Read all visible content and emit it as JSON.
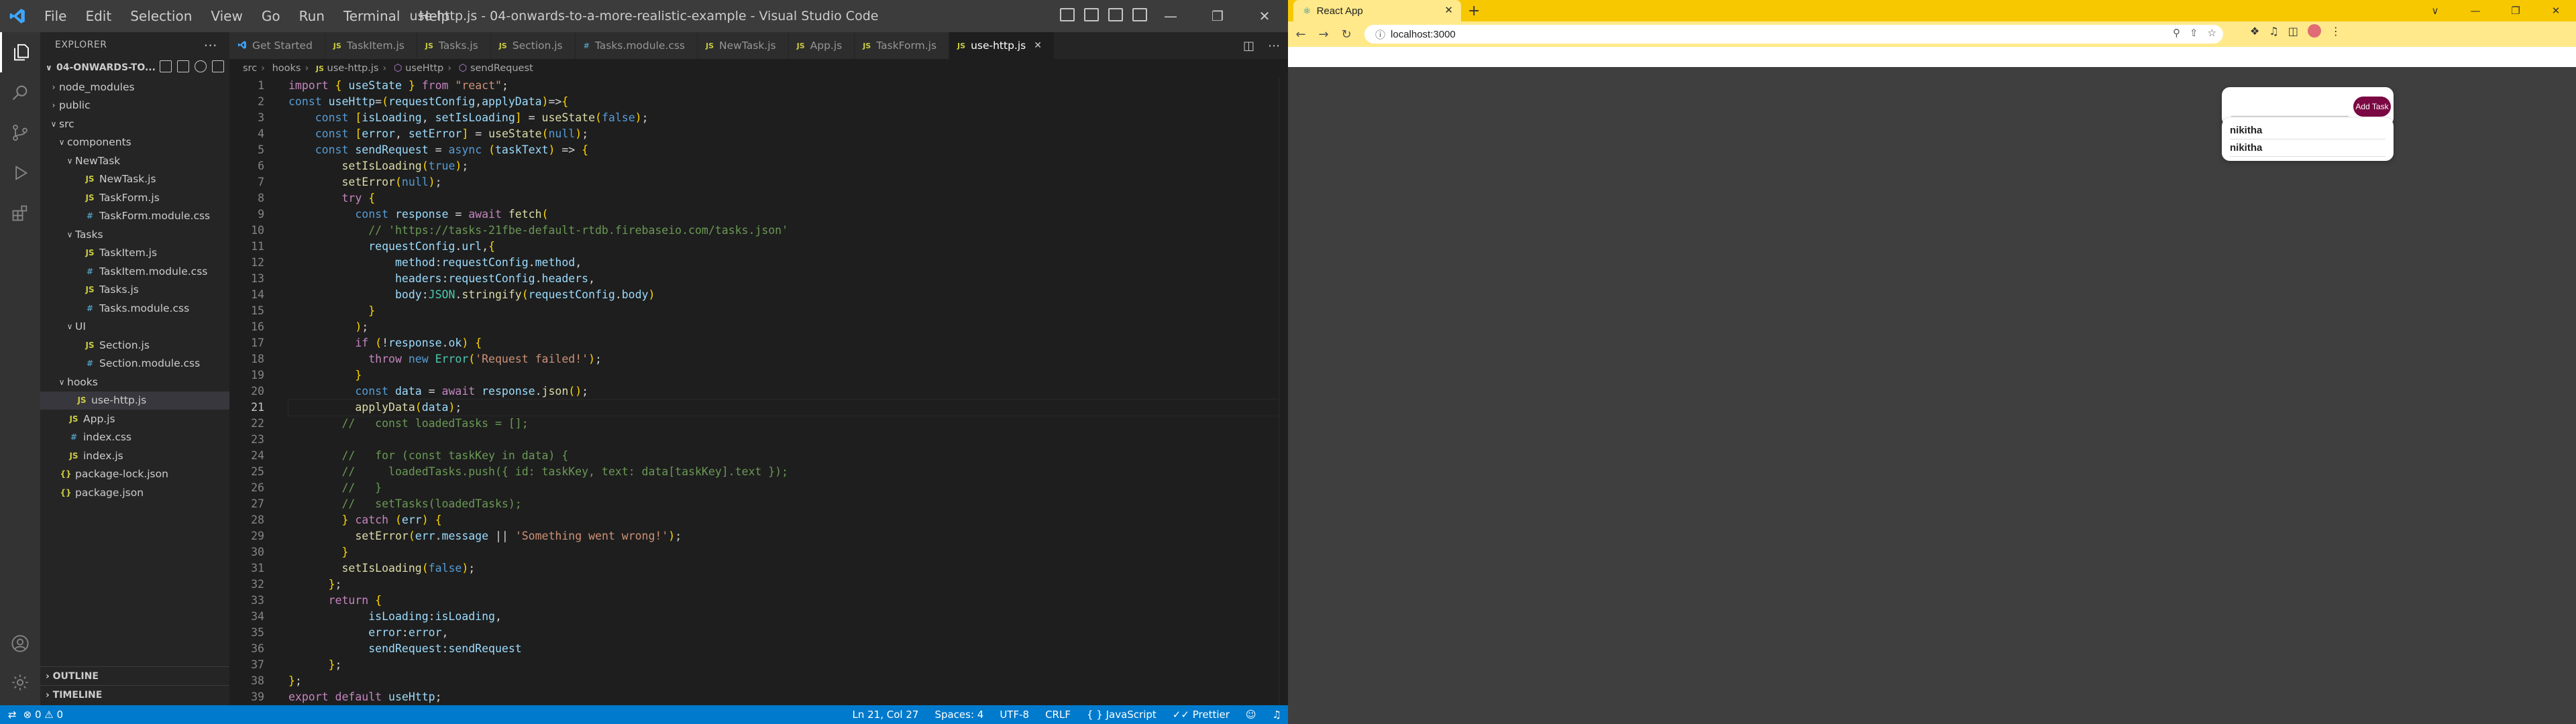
{
  "vscode": {
    "window_title": "use-http.js - 04-onwards-to-a-more-realistic-example - Visual Studio Code",
    "menu": [
      "File",
      "Edit",
      "Selection",
      "View",
      "Go",
      "Run",
      "Terminal",
      "Help"
    ],
    "explorer": {
      "header": "EXPLORER",
      "root_folder": "04-ONWARDS-TO...",
      "tree": [
        {
          "label": "node_modules",
          "kind": "folder",
          "depth": 1,
          "open": false
        },
        {
          "label": "public",
          "kind": "folder",
          "depth": 1,
          "open": false
        },
        {
          "label": "src",
          "kind": "folder",
          "depth": 1,
          "open": true
        },
        {
          "label": "components",
          "kind": "folder",
          "depth": 2,
          "open": true
        },
        {
          "label": "NewTask",
          "kind": "folder",
          "depth": 3,
          "open": true
        },
        {
          "label": "NewTask.js",
          "kind": "js",
          "depth": 4
        },
        {
          "label": "TaskForm.js",
          "kind": "js",
          "depth": 4
        },
        {
          "label": "TaskForm.module.css",
          "kind": "css",
          "depth": 4
        },
        {
          "label": "Tasks",
          "kind": "folder",
          "depth": 3,
          "open": true
        },
        {
          "label": "TaskItem.js",
          "kind": "js",
          "depth": 4
        },
        {
          "label": "TaskItem.module.css",
          "kind": "css",
          "depth": 4
        },
        {
          "label": "Tasks.js",
          "kind": "js",
          "depth": 4
        },
        {
          "label": "Tasks.module.css",
          "kind": "css",
          "depth": 4
        },
        {
          "label": "UI",
          "kind": "folder",
          "depth": 3,
          "open": true
        },
        {
          "label": "Section.js",
          "kind": "js",
          "depth": 4
        },
        {
          "label": "Section.module.css",
          "kind": "css",
          "depth": 4
        },
        {
          "label": "hooks",
          "kind": "folder",
          "depth": 2,
          "open": true
        },
        {
          "label": "use-http.js",
          "kind": "js",
          "depth": 3,
          "selected": true
        },
        {
          "label": "App.js",
          "kind": "js",
          "depth": 2
        },
        {
          "label": "index.css",
          "kind": "css",
          "depth": 2
        },
        {
          "label": "index.js",
          "kind": "js",
          "depth": 2
        },
        {
          "label": "package-lock.json",
          "kind": "json",
          "depth": 1
        },
        {
          "label": "package.json",
          "kind": "json",
          "depth": 1
        }
      ],
      "outline": "OUTLINE",
      "timeline": "TIMELINE"
    },
    "tabs": [
      {
        "label": "Get Started",
        "icon": "vscode-logo-icon",
        "active": false
      },
      {
        "label": "TaskItem.js",
        "icon": "JS",
        "active": false
      },
      {
        "label": "Tasks.js",
        "icon": "JS",
        "active": false
      },
      {
        "label": "Section.js",
        "icon": "JS",
        "active": false
      },
      {
        "label": "Tasks.module.css",
        "icon": "#",
        "active": false
      },
      {
        "label": "NewTask.js",
        "icon": "JS",
        "active": false
      },
      {
        "label": "App.js",
        "icon": "JS",
        "active": false
      },
      {
        "label": "TaskForm.js",
        "icon": "JS",
        "active": false
      },
      {
        "label": "use-http.js",
        "icon": "JS",
        "active": true
      }
    ],
    "breadcrumb": [
      "src",
      "hooks",
      "use-http.js",
      "useHttp",
      "sendRequest"
    ],
    "active_line": 21,
    "code_lines": [
      "import { useState } from \"react\";",
      "const useHttp=(requestConfig,applyData)=>{",
      "    const [isLoading, setIsLoading] = useState(false);",
      "    const [error, setError] = useState(null);",
      "    const sendRequest = async (taskText) => {",
      "        setIsLoading(true);",
      "        setError(null);",
      "        try {",
      "          const response = await fetch(",
      "            // 'https://tasks-21fbe-default-rtdb.firebaseio.com/tasks.json'",
      "            requestConfig.url,{",
      "                method:requestConfig.method,",
      "                headers:requestConfig.headers,",
      "                body:JSON.stringify(requestConfig.body)",
      "            }",
      "          );",
      "          if (!response.ok) {",
      "            throw new Error('Request failed!');",
      "          }",
      "          const data = await response.json();",
      "          applyData(data);",
      "        //   const loadedTasks = [];",
      "",
      "        //   for (const taskKey in data) {",
      "        //     loadedTasks.push({ id: taskKey, text: data[taskKey].text });",
      "        //   }",
      "        //   setTasks(loadedTasks);",
      "        } catch (err) {",
      "          setError(err.message || 'Something went wrong!');",
      "        }",
      "        setIsLoading(false);",
      "      };",
      "      return {",
      "            isLoading:isLoading,",
      "            error:error,",
      "            sendRequest:sendRequest",
      "      };",
      "};",
      "export default useHttp;"
    ],
    "status": {
      "errors": "0",
      "warnings": "0",
      "position": "Ln 21, Col 27",
      "spaces": "Spaces: 4",
      "encoding": "UTF-8",
      "eol": "CRLF",
      "language": "JavaScript",
      "formatter": "Prettier"
    }
  },
  "browser": {
    "tab_title": "React App",
    "url": "localhost:3000",
    "page": {
      "add_button_label": "Add Task",
      "input_value": "",
      "tasks": [
        "nikitha",
        "nikitha"
      ]
    }
  }
}
